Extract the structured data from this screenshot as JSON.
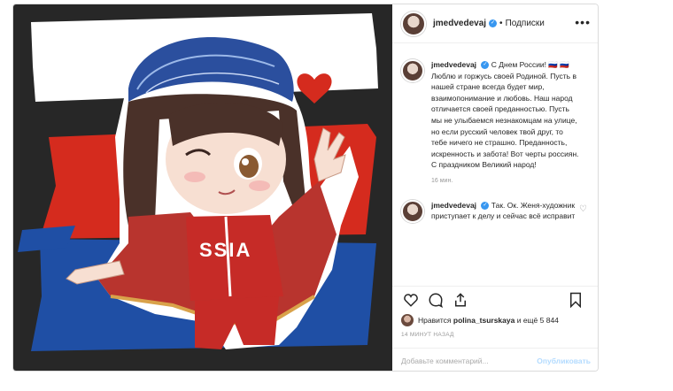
{
  "post": {
    "username": "jmedvedevaj",
    "separator": "•",
    "follow_label": "Подписки",
    "more_label": "•••",
    "caption": {
      "username": "jmedvedevaj",
      "text": "С Днем России! 🇷🇺 🇷🇺 Люблю и горжусь своей Родиной. Пусть в нашей стране всегда будет мир, взаимопонимание и любовь. Наш народ отличается своей преданностью. Пусть мы не улыбаемся незнакомцам на улице, но если русский человек твой друг, то тебе ничего не страшно. Преданность, искренность и забота! Вот черты россиян. С праздником Великий народ!",
      "time": "16 мин."
    },
    "reply": {
      "username": "jmedvedevaj",
      "text": "Так. Ок. Женя-художник приступает к делу и сейчас всё исправит"
    },
    "likes": {
      "prefix": "Нравится",
      "user": "polina_tsurskaya",
      "suffix": "и ещё 5 844"
    },
    "posted_ago": "14 МИНУТ НАЗАД",
    "comment_placeholder": "Добавьте комментарий...",
    "publish_label": "Опубликовать"
  },
  "artwork": {
    "jacket_text": "SSIA",
    "flag_colors": [
      "#ffffff",
      "#d52b1e",
      "#1f4fa5"
    ]
  },
  "icons": [
    "heart-icon",
    "comment-icon",
    "share-icon",
    "bookmark-icon",
    "more-icon",
    "verified-icon"
  ]
}
